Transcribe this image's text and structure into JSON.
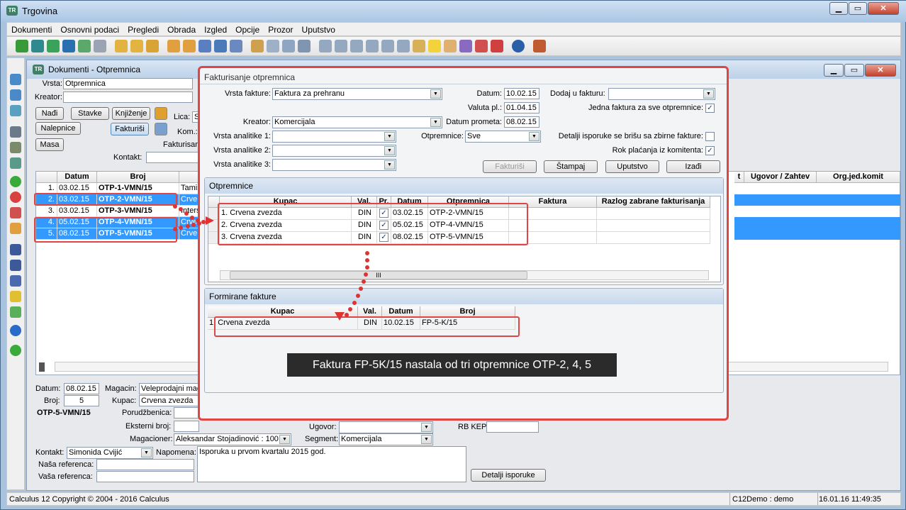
{
  "app": {
    "title": "Trgovina",
    "icon": "trgovina-app-icon"
  },
  "menu": [
    "Dokumenti",
    "Osnovni podaci",
    "Pregledi",
    "Obrada",
    "Izgled",
    "Opcije",
    "Prozor",
    "Uputstvo"
  ],
  "child": {
    "title": "Dokumenti - Otpremnica"
  },
  "doc": {
    "vrsta_label": "Vrsta:",
    "vrsta_value": "Otpremnica",
    "kreator_label": "Kreator:",
    "kreator_value": "",
    "btn_nadji": "Nađi",
    "btn_stavke": "Stavke",
    "btn_knjizenje": "Knjiženje",
    "btn_nalepnice": "Nalepnice",
    "btn_fakturisi": "Fakturiši",
    "btn_masa": "Masa",
    "lica_label": "Lica:",
    "kom_label": "Kom.:",
    "fakturisane_label": "Fakturisane:",
    "kontakt_label": "Kontakt:",
    "lica_value": "S"
  },
  "main_grid": {
    "headers": [
      "Datum",
      "Broj"
    ],
    "right_headers": [
      "t",
      "Ugovor / Zahtev",
      "Org.jed.komit"
    ],
    "rows": [
      {
        "n": "1.",
        "datum": "03.02.15",
        "broj": "OTP-1-VMN/15",
        "extra": "Tamiš",
        "sel": false
      },
      {
        "n": "2.",
        "datum": "03.02.15",
        "broj": "OTP-2-VMN/15",
        "extra": "Crve",
        "sel": true
      },
      {
        "n": "3.",
        "datum": "03.02.15",
        "broj": "OTP-3-VMN/15",
        "extra": "Inters",
        "sel": false
      },
      {
        "n": "4.",
        "datum": "05.02.15",
        "broj": "OTP-4-VMN/15",
        "extra": "Crve",
        "sel": true
      },
      {
        "n": "5.",
        "datum": "08.02.15",
        "broj": "OTP-5-VMN/15",
        "extra": "Crve",
        "sel": true
      }
    ]
  },
  "bottom": {
    "datum_label": "Datum:",
    "datum_value": "08.02.15",
    "magacin_label": "Magacin:",
    "magacin_value": "Veleprodajni mag",
    "broj_label": "Broj:",
    "broj_value": "5",
    "kupac_label": "Kupac:",
    "kupac_value": "Crvena zvezda",
    "doc_id": "OTP-5-VMN/15",
    "porudzbenica_label": "Porudžbenica:",
    "eksterni_label": "Eksterni broj:",
    "ugovor_label": "Ugovor:",
    "rbkepu_label": "RB KEPU:",
    "magacioner_label": "Magacioner:",
    "magacioner_value": "Aleksandar Stojadinović : 100",
    "segment_label": "Segment:",
    "segment_value": "Komercijala",
    "kontakt_label": "Kontakt:",
    "kontakt_value": "Simonida Cvijić",
    "napomena_label": "Napomena:",
    "napomena_value": "Isporuka u prvom kvartalu 2015 god.",
    "nasa_label": "Naša referenca:",
    "vasa_label": "Vaša referenca:",
    "btn_detalji": "Detalji isporuke"
  },
  "dialog": {
    "title": "Fakturisanje otpremnica",
    "vrsta_fakture_label": "Vrsta fakture:",
    "vrsta_fakture_value": "Faktura za prehranu",
    "datum_label": "Datum:",
    "datum_value": "10.02.15",
    "valuta_label": "Valuta pl.:",
    "valuta_value": "01.04.15",
    "datum_prometa_label": "Datum prometa:",
    "datum_prometa_value": "08.02.15",
    "dodaj_label": "Dodaj u fakturu:",
    "jedna_label": "Jedna faktura za sve otpremnice:",
    "kreator_label": "Kreator:",
    "kreator_value": "Komercijala",
    "otpremnice_label": "Otpremnice:",
    "otpremnice_value": "Sve",
    "va1": "Vrsta analitike 1:",
    "va2": "Vrsta analitike 2:",
    "va3": "Vrsta analitike 3:",
    "detalji_label": "Detalji isporuke se brišu sa zbirne fakture:",
    "rok_label": "Rok plaćanja iz komitenta:",
    "btn_fakturisi": "Fakturiši",
    "btn_stampaj": "Štampaj",
    "btn_uputstvo": "Uputstvo",
    "btn_izadji": "Izađi",
    "otp_section": "Otpremnice",
    "otp_headers": [
      "Kupac",
      "Val.",
      "Pr.",
      "Datum",
      "Otpremnica",
      "Faktura",
      "Razlog zabrane fakturisanja"
    ],
    "otp_rows": [
      {
        "n": "1.",
        "kupac": "Crvena zvezda",
        "val": "DIN",
        "datum": "03.02.15",
        "otp": "OTP-2-VMN/15"
      },
      {
        "n": "2.",
        "kupac": "Crvena zvezda",
        "val": "DIN",
        "datum": "05.02.15",
        "otp": "OTP-4-VMN/15"
      },
      {
        "n": "3.",
        "kupac": "Crvena zvezda",
        "val": "DIN",
        "datum": "08.02.15",
        "otp": "OTP-5-VMN/15"
      }
    ],
    "ff_section": "Formirane fakture",
    "ff_headers": [
      "Kupac",
      "Val.",
      "Datum",
      "Broj"
    ],
    "ff_rows": [
      {
        "n": "1.",
        "kupac": "Crvena zvezda",
        "val": "DIN",
        "datum": "10.02.15",
        "broj": "FP-5-K/15"
      }
    ]
  },
  "caption": "Faktura FP-5K/15 nastala od tri otpremnice OTP-2, 4, 5",
  "status": {
    "left": "Calculus 12  Copyright © 2004 - 2016  Calculus",
    "user": "C12Demo : demo",
    "time": "16.01.16 11:49:35"
  },
  "colors": {
    "selection": "#3399ff",
    "highlight_red": "#e04545",
    "caption_bg": "#2b2b2b"
  }
}
